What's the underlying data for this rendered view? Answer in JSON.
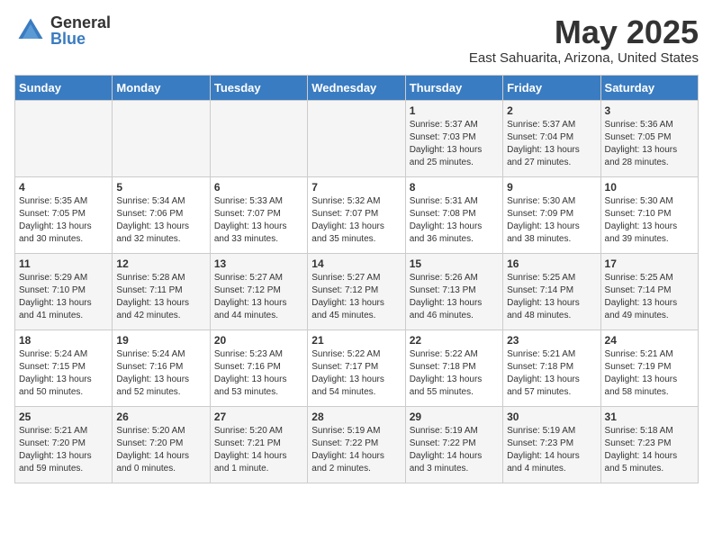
{
  "logo": {
    "general": "General",
    "blue": "Blue"
  },
  "title": {
    "month_year": "May 2025",
    "location": "East Sahuarita, Arizona, United States"
  },
  "weekdays": [
    "Sunday",
    "Monday",
    "Tuesday",
    "Wednesday",
    "Thursday",
    "Friday",
    "Saturday"
  ],
  "weeks": [
    [
      {
        "day": "",
        "info": ""
      },
      {
        "day": "",
        "info": ""
      },
      {
        "day": "",
        "info": ""
      },
      {
        "day": "",
        "info": ""
      },
      {
        "day": "1",
        "info": "Sunrise: 5:37 AM\nSunset: 7:03 PM\nDaylight: 13 hours\nand 25 minutes."
      },
      {
        "day": "2",
        "info": "Sunrise: 5:37 AM\nSunset: 7:04 PM\nDaylight: 13 hours\nand 27 minutes."
      },
      {
        "day": "3",
        "info": "Sunrise: 5:36 AM\nSunset: 7:05 PM\nDaylight: 13 hours\nand 28 minutes."
      }
    ],
    [
      {
        "day": "4",
        "info": "Sunrise: 5:35 AM\nSunset: 7:05 PM\nDaylight: 13 hours\nand 30 minutes."
      },
      {
        "day": "5",
        "info": "Sunrise: 5:34 AM\nSunset: 7:06 PM\nDaylight: 13 hours\nand 32 minutes."
      },
      {
        "day": "6",
        "info": "Sunrise: 5:33 AM\nSunset: 7:07 PM\nDaylight: 13 hours\nand 33 minutes."
      },
      {
        "day": "7",
        "info": "Sunrise: 5:32 AM\nSunset: 7:07 PM\nDaylight: 13 hours\nand 35 minutes."
      },
      {
        "day": "8",
        "info": "Sunrise: 5:31 AM\nSunset: 7:08 PM\nDaylight: 13 hours\nand 36 minutes."
      },
      {
        "day": "9",
        "info": "Sunrise: 5:30 AM\nSunset: 7:09 PM\nDaylight: 13 hours\nand 38 minutes."
      },
      {
        "day": "10",
        "info": "Sunrise: 5:30 AM\nSunset: 7:10 PM\nDaylight: 13 hours\nand 39 minutes."
      }
    ],
    [
      {
        "day": "11",
        "info": "Sunrise: 5:29 AM\nSunset: 7:10 PM\nDaylight: 13 hours\nand 41 minutes."
      },
      {
        "day": "12",
        "info": "Sunrise: 5:28 AM\nSunset: 7:11 PM\nDaylight: 13 hours\nand 42 minutes."
      },
      {
        "day": "13",
        "info": "Sunrise: 5:27 AM\nSunset: 7:12 PM\nDaylight: 13 hours\nand 44 minutes."
      },
      {
        "day": "14",
        "info": "Sunrise: 5:27 AM\nSunset: 7:12 PM\nDaylight: 13 hours\nand 45 minutes."
      },
      {
        "day": "15",
        "info": "Sunrise: 5:26 AM\nSunset: 7:13 PM\nDaylight: 13 hours\nand 46 minutes."
      },
      {
        "day": "16",
        "info": "Sunrise: 5:25 AM\nSunset: 7:14 PM\nDaylight: 13 hours\nand 48 minutes."
      },
      {
        "day": "17",
        "info": "Sunrise: 5:25 AM\nSunset: 7:14 PM\nDaylight: 13 hours\nand 49 minutes."
      }
    ],
    [
      {
        "day": "18",
        "info": "Sunrise: 5:24 AM\nSunset: 7:15 PM\nDaylight: 13 hours\nand 50 minutes."
      },
      {
        "day": "19",
        "info": "Sunrise: 5:24 AM\nSunset: 7:16 PM\nDaylight: 13 hours\nand 52 minutes."
      },
      {
        "day": "20",
        "info": "Sunrise: 5:23 AM\nSunset: 7:16 PM\nDaylight: 13 hours\nand 53 minutes."
      },
      {
        "day": "21",
        "info": "Sunrise: 5:22 AM\nSunset: 7:17 PM\nDaylight: 13 hours\nand 54 minutes."
      },
      {
        "day": "22",
        "info": "Sunrise: 5:22 AM\nSunset: 7:18 PM\nDaylight: 13 hours\nand 55 minutes."
      },
      {
        "day": "23",
        "info": "Sunrise: 5:21 AM\nSunset: 7:18 PM\nDaylight: 13 hours\nand 57 minutes."
      },
      {
        "day": "24",
        "info": "Sunrise: 5:21 AM\nSunset: 7:19 PM\nDaylight: 13 hours\nand 58 minutes."
      }
    ],
    [
      {
        "day": "25",
        "info": "Sunrise: 5:21 AM\nSunset: 7:20 PM\nDaylight: 13 hours\nand 59 minutes."
      },
      {
        "day": "26",
        "info": "Sunrise: 5:20 AM\nSunset: 7:20 PM\nDaylight: 14 hours\nand 0 minutes."
      },
      {
        "day": "27",
        "info": "Sunrise: 5:20 AM\nSunset: 7:21 PM\nDaylight: 14 hours\nand 1 minute."
      },
      {
        "day": "28",
        "info": "Sunrise: 5:19 AM\nSunset: 7:22 PM\nDaylight: 14 hours\nand 2 minutes."
      },
      {
        "day": "29",
        "info": "Sunrise: 5:19 AM\nSunset: 7:22 PM\nDaylight: 14 hours\nand 3 minutes."
      },
      {
        "day": "30",
        "info": "Sunrise: 5:19 AM\nSunset: 7:23 PM\nDaylight: 14 hours\nand 4 minutes."
      },
      {
        "day": "31",
        "info": "Sunrise: 5:18 AM\nSunset: 7:23 PM\nDaylight: 14 hours\nand 5 minutes."
      }
    ]
  ]
}
